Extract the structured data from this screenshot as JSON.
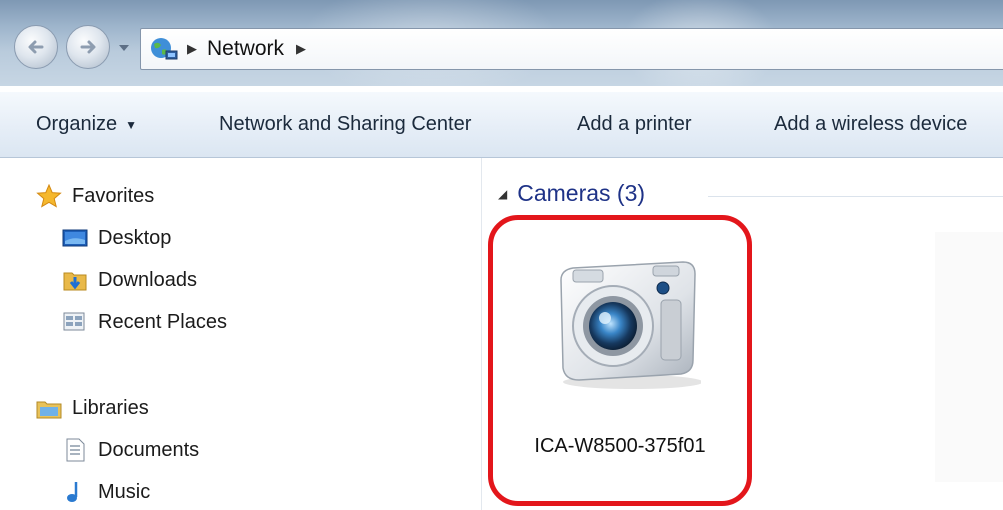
{
  "address_bar": {
    "breadcrumb": [
      "Network"
    ],
    "icon": "network-globe-icon"
  },
  "toolbar": {
    "organize_label": "Organize",
    "network_sharing_label": "Network and Sharing Center",
    "add_printer_label": "Add a printer",
    "add_wireless_label": "Add a wireless device"
  },
  "nav_pane": {
    "favorites": {
      "label": "Favorites",
      "icon": "star-icon",
      "items": [
        {
          "label": "Desktop",
          "icon": "desktop-icon"
        },
        {
          "label": "Downloads",
          "icon": "downloads-icon"
        },
        {
          "label": "Recent Places",
          "icon": "recent-places-icon"
        }
      ]
    },
    "libraries": {
      "label": "Libraries",
      "icon": "libraries-icon",
      "items": [
        {
          "label": "Documents",
          "icon": "documents-icon"
        },
        {
          "label": "Music",
          "icon": "music-icon"
        }
      ]
    }
  },
  "content": {
    "group_title": "Cameras (3)",
    "items": [
      {
        "label": "ICA-W8500-375f01",
        "icon": "camera-icon"
      }
    ]
  },
  "colors": {
    "highlight_ring": "#e3161b",
    "group_header": "#1e3287"
  }
}
